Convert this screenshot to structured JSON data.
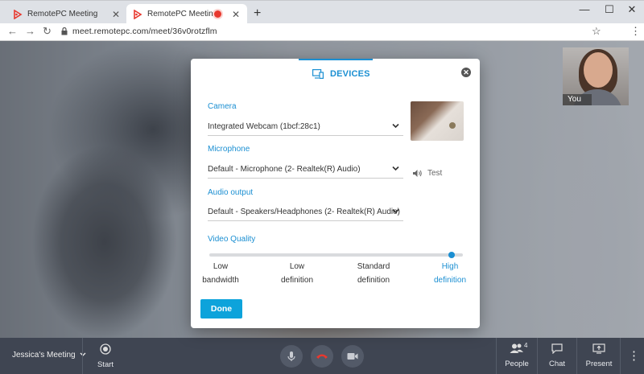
{
  "browser": {
    "tabs": [
      {
        "title": "RemotePC Meeting",
        "active": false
      },
      {
        "title": "RemotePC Meeting",
        "active": true
      }
    ],
    "url": "meet.remotepc.com/meet/36v0rotzflm",
    "new_tab": "+",
    "close_tab": "✕",
    "controls": {
      "minimize": "—",
      "maximize": "☐",
      "close": "✕"
    }
  },
  "self_view": {
    "label": "You"
  },
  "modal": {
    "title": "DEVICES",
    "camera": {
      "label": "Camera",
      "value": "Integrated Webcam (1bcf:28c1)"
    },
    "microphone": {
      "label": "Microphone",
      "value": "Default - Microphone (2- Realtek(R) Audio)",
      "test_label": "Test"
    },
    "audio_output": {
      "label": "Audio output",
      "value": "Default - Speakers/Headphones (2- Realtek(R) Audio)"
    },
    "video_quality": {
      "label": "Video Quality",
      "selected_index": 3,
      "options": [
        {
          "line1": "Low",
          "line2": "bandwidth"
        },
        {
          "line1": "Low",
          "line2": "definition"
        },
        {
          "line1": "Standard",
          "line2": "definition"
        },
        {
          "line1": "High",
          "line2": "definition"
        }
      ]
    },
    "done_label": "Done"
  },
  "bottombar": {
    "meeting_name": "Jessica's Meeting",
    "start_label": "Start",
    "people_label": "People",
    "people_count": "4",
    "chat_label": "Chat",
    "present_label": "Present"
  },
  "colors": {
    "accent": "#1b8fd2",
    "done_button": "#0da3db",
    "bottombar": "#3f4552",
    "end_call": "#e8382e"
  }
}
